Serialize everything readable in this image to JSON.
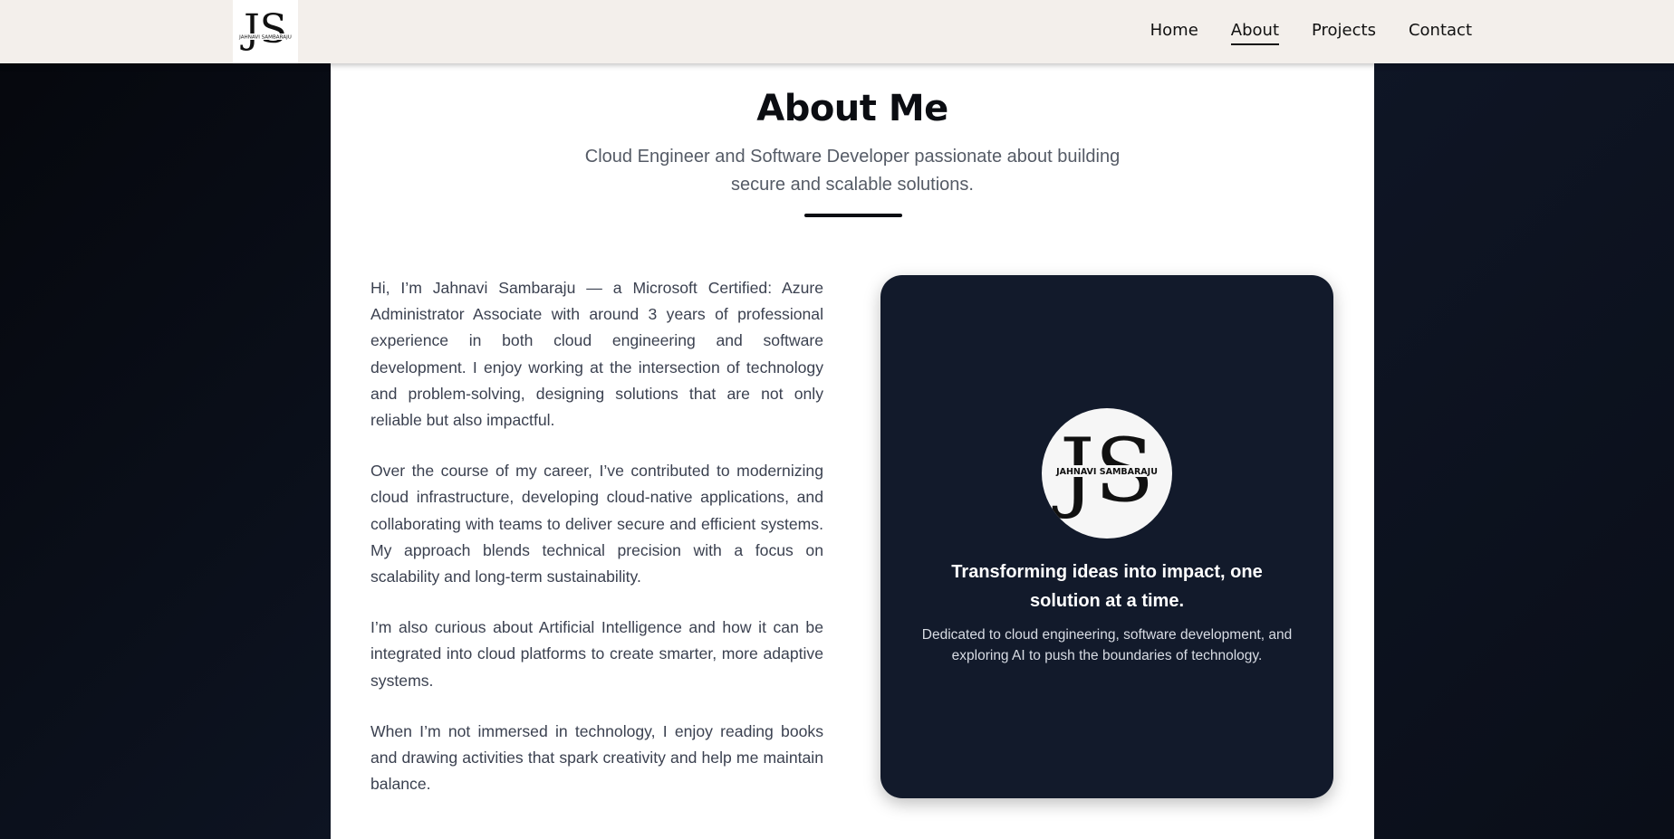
{
  "header": {
    "logo": {
      "monogram": "JS",
      "name": "JAHNAVI SAMBARAJU"
    },
    "nav": [
      {
        "label": "Home"
      },
      {
        "label": "About"
      },
      {
        "label": "Projects"
      },
      {
        "label": "Contact"
      }
    ],
    "active_nav": "About"
  },
  "main": {
    "title": "About Me",
    "subtitle": "Cloud Engineer and Software Developer passionate about building secure and scalable solutions.",
    "paragraphs": [
      "Hi, I’m Jahnavi Sambaraju — a Microsoft Certified: Azure Administrator Associate with around 3 years of professional experience in both cloud engineering and software development. I enjoy working at the intersection of technology and problem-solving, designing solutions that are not only reliable but also impactful.",
      "Over the course of my career, I’ve contributed to modernizing cloud infrastructure, developing cloud-native applications, and collaborating with teams to deliver secure and efficient systems. My approach blends technical precision with a focus on scalability and long-term sustainability.",
      "I’m also curious about Artificial Intelligence and how it can be integrated into cloud platforms to create smarter, more adaptive systems.",
      "When I’m not immersed in technology, I enjoy reading books and drawing activities that spark creativity and help me maintain balance."
    ],
    "card": {
      "avatar": {
        "monogram": "JS",
        "name": "JAHNAVI SAMBARAJU"
      },
      "headline": "Transforming ideas into impact, one solution at a time.",
      "text": "Dedicated to cloud engineering, software development, and exploring AI to push the boundaries of technology."
    }
  },
  "colors": {
    "header_bg": "#f3efeb",
    "page_bg": "#0b101b",
    "card_bg": "#121a2b",
    "text_dark": "#0b0d12",
    "text_body": "#3b4150"
  }
}
